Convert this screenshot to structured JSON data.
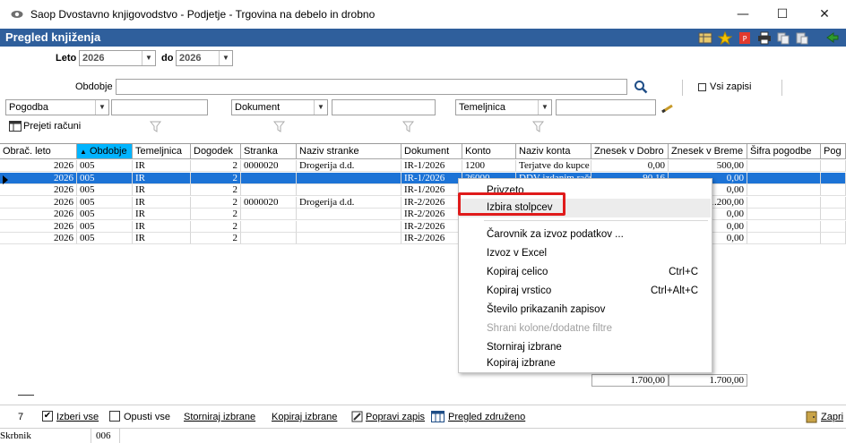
{
  "window": {
    "title": "Saop  Dvostavno knjigovodstvo - Podjetje - Trgovina na debelo in drobno",
    "controls": [
      "—",
      "☐",
      "✕"
    ]
  },
  "panel": {
    "title": "Pregled knjiženja"
  },
  "filters": {
    "leto_label": "Leto",
    "leto_from": "2026",
    "do_label": "do",
    "leto_to": "2026",
    "obdobje_label": "Obdobje",
    "obdobje_value": "",
    "vsi_zapisi_label": "Vsi zapisi",
    "pogodba": "Pogodba",
    "dokument": "Dokument",
    "temeljnica": "Temeljnica",
    "prejeti_racuni": "Prejeti računi"
  },
  "table": {
    "columns": [
      "Obrač. leto",
      "Obdobje",
      "Temeljnica",
      "Dogodek",
      "Stranka",
      "Naziv stranke",
      "Dokument",
      "Konto",
      "Naziv konta",
      "Znesek v Dobro",
      "Znesek v Breme",
      "Šifra pogodbe",
      "Pog"
    ],
    "sort_indicator": "▲",
    "rows": [
      [
        "2026",
        "005",
        "IR",
        "2",
        "0000020",
        "Drogerija d.d.",
        "IR-1/2026",
        "1200",
        "Terjatve do kupce",
        "0,00",
        "500,00"
      ],
      [
        "2026",
        "005",
        "IR",
        "2",
        "",
        "",
        "IR-1/2026",
        "26000",
        "DDV izdanim računom",
        "90,16",
        "0,00"
      ],
      [
        "2026",
        "005",
        "IR",
        "2",
        "",
        "",
        "IR-1/2026",
        "",
        "",
        "",
        "0,00"
      ],
      [
        "2026",
        "005",
        "IR",
        "2",
        "0000020",
        "Drogerija d.d.",
        "IR-2/2026",
        "",
        "",
        "",
        "1.200,00"
      ],
      [
        "2026",
        "005",
        "IR",
        "2",
        "",
        "",
        "IR-2/2026",
        "",
        "",
        "",
        "0,00"
      ],
      [
        "2026",
        "005",
        "IR",
        "2",
        "",
        "",
        "IR-2/2026",
        "",
        "",
        "",
        "0,00"
      ],
      [
        "2026",
        "005",
        "IR",
        "2",
        "",
        "",
        "IR-2/2026",
        "",
        "",
        "",
        "0,00"
      ]
    ],
    "totals": {
      "dobro": "1.700,00",
      "breme": "1.700,00"
    }
  },
  "context_menu": {
    "items": [
      {
        "label": "Privzeto",
        "shortcut": ""
      },
      {
        "label": "Izbira stolpcev",
        "shortcut": ""
      },
      {
        "label": "Čarovnik za izvoz podatkov ...",
        "shortcut": ""
      },
      {
        "label": "Izvoz v Excel",
        "shortcut": ""
      },
      {
        "label": "Kopiraj celico",
        "shortcut": "Ctrl+C"
      },
      {
        "label": "Kopiraj vrstico",
        "shortcut": "Ctrl+Alt+C"
      },
      {
        "label": "Število prikazanih zapisov",
        "shortcut": ""
      },
      {
        "label": "Shrani kolone/dodatne filtre",
        "shortcut": ""
      },
      {
        "label": "Storniraj izbrane",
        "shortcut": ""
      },
      {
        "label": "Kopiraj izbrane",
        "shortcut": ""
      }
    ]
  },
  "bottom": {
    "count": "7",
    "izberi_vse": "Izberi vse",
    "opusti_vse": "Opusti vse",
    "storniraj": "Storniraj izbrane",
    "kopiraj": "Kopiraj izbrane",
    "popravi": "Popravi zapis",
    "pregled": "Pregled združeno",
    "zapri": "Zapri"
  },
  "status": {
    "label": "Skrbnik",
    "value": "006"
  },
  "colors": {
    "header": "#2f5f9c",
    "selection": "#1c73d6",
    "highlight": "#e01b1b",
    "accent_sort": "#00b4ff"
  }
}
